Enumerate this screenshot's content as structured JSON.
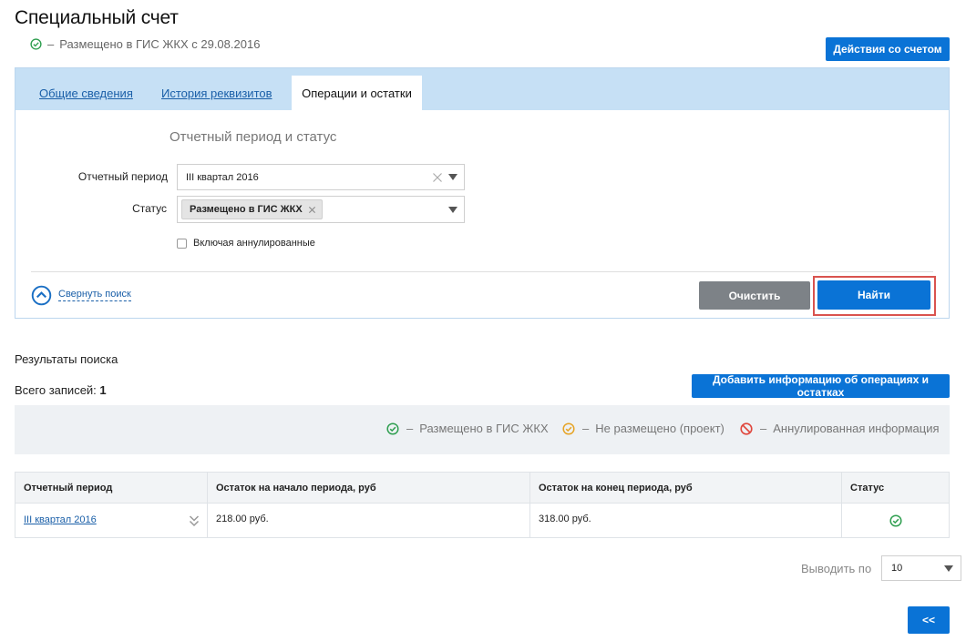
{
  "header": {
    "title": "Специальный счет",
    "status_dash": "–",
    "status_text": "Размещено в ГИС ЖКХ с 29.08.2016",
    "actions_button": "Действия со счетом"
  },
  "tabs": [
    {
      "label": "Общие сведения",
      "active": false
    },
    {
      "label": "История реквизитов",
      "active": false
    },
    {
      "label": "Операции и остатки",
      "active": true
    }
  ],
  "search": {
    "section_title": "Отчетный период и статус",
    "period_label": "Отчетный период",
    "period_value": "III квартал 2016",
    "status_label": "Статус",
    "status_chip": "Размещено в ГИС ЖКХ",
    "include_cancelled_label": "Включая аннулированные",
    "collapse_link": "Свернуть поиск",
    "clear_button": "Очистить",
    "find_button": "Найти"
  },
  "results": {
    "title": "Результаты поиска",
    "total_label": "Всего записей:",
    "total_count": "1",
    "add_button": "Добавить информацию об операциях и остатках",
    "legend": [
      {
        "icon": "check-circle-icon",
        "color": "#2e9e4f",
        "dash": "–",
        "label": "Размещено в ГИС ЖКХ"
      },
      {
        "icon": "check-circle-icon",
        "color": "#e6a323",
        "dash": "–",
        "label": "Не размещено (проект)"
      },
      {
        "icon": "ban-icon",
        "color": "#e0463c",
        "dash": "–",
        "label": "Аннулированная информация"
      }
    ],
    "columns": [
      "Отчетный период",
      "Остаток на начало периода, руб",
      "Остаток на конец периода, руб",
      "Статус"
    ],
    "rows": [
      {
        "period": "III квартал 2016",
        "start_balance": "218.00 руб.",
        "end_balance": "318.00 руб.",
        "status_icon": "check-circle-icon"
      }
    ]
  },
  "pagination": {
    "per_page_label": "Выводить по",
    "per_page_value": "10",
    "prev_button": "<<"
  },
  "colors": {
    "primary": "#0a73d6",
    "success": "#2e9e4f",
    "warning": "#e6a323",
    "danger": "#e0463c",
    "tab_strip": "#c6e0f5"
  }
}
